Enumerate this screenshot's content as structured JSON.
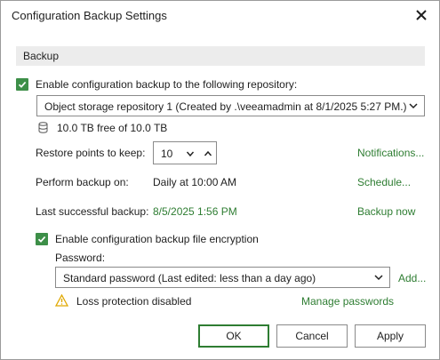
{
  "window": {
    "title": "Configuration Backup Settings"
  },
  "section": {
    "label": "Backup"
  },
  "enable_backup": {
    "label": "Enable configuration backup to the following repository:",
    "checked": true
  },
  "repository": {
    "selected": "Object storage repository 1 (Created by .\\veeamadmin at 8/1/2025 5:27 PM.)",
    "capacity": "10.0 TB free of 10.0 TB"
  },
  "restore_points": {
    "label": "Restore points to keep:",
    "value": "10"
  },
  "notifications_link": "Notifications...",
  "perform_backup": {
    "label": "Perform backup on:",
    "value": "Daily at 10:00 AM"
  },
  "schedule_link": "Schedule...",
  "last_backup": {
    "label": "Last successful backup:",
    "value": "8/5/2025 1:56 PM"
  },
  "backup_now_link": "Backup now",
  "encryption": {
    "label": "Enable configuration backup file encryption",
    "checked": true
  },
  "password": {
    "label": "Password:",
    "selected": "Standard password (Last edited: less than a day ago)"
  },
  "add_link": "Add...",
  "loss_protection": {
    "text": "Loss protection disabled"
  },
  "manage_passwords_link": "Manage passwords",
  "buttons": {
    "ok": "OK",
    "cancel": "Cancel",
    "apply": "Apply"
  },
  "colors": {
    "accent": "#2e7d32",
    "checkbox": "#3d8f48",
    "warning": "#e0a800",
    "header_bg": "#ececec"
  }
}
